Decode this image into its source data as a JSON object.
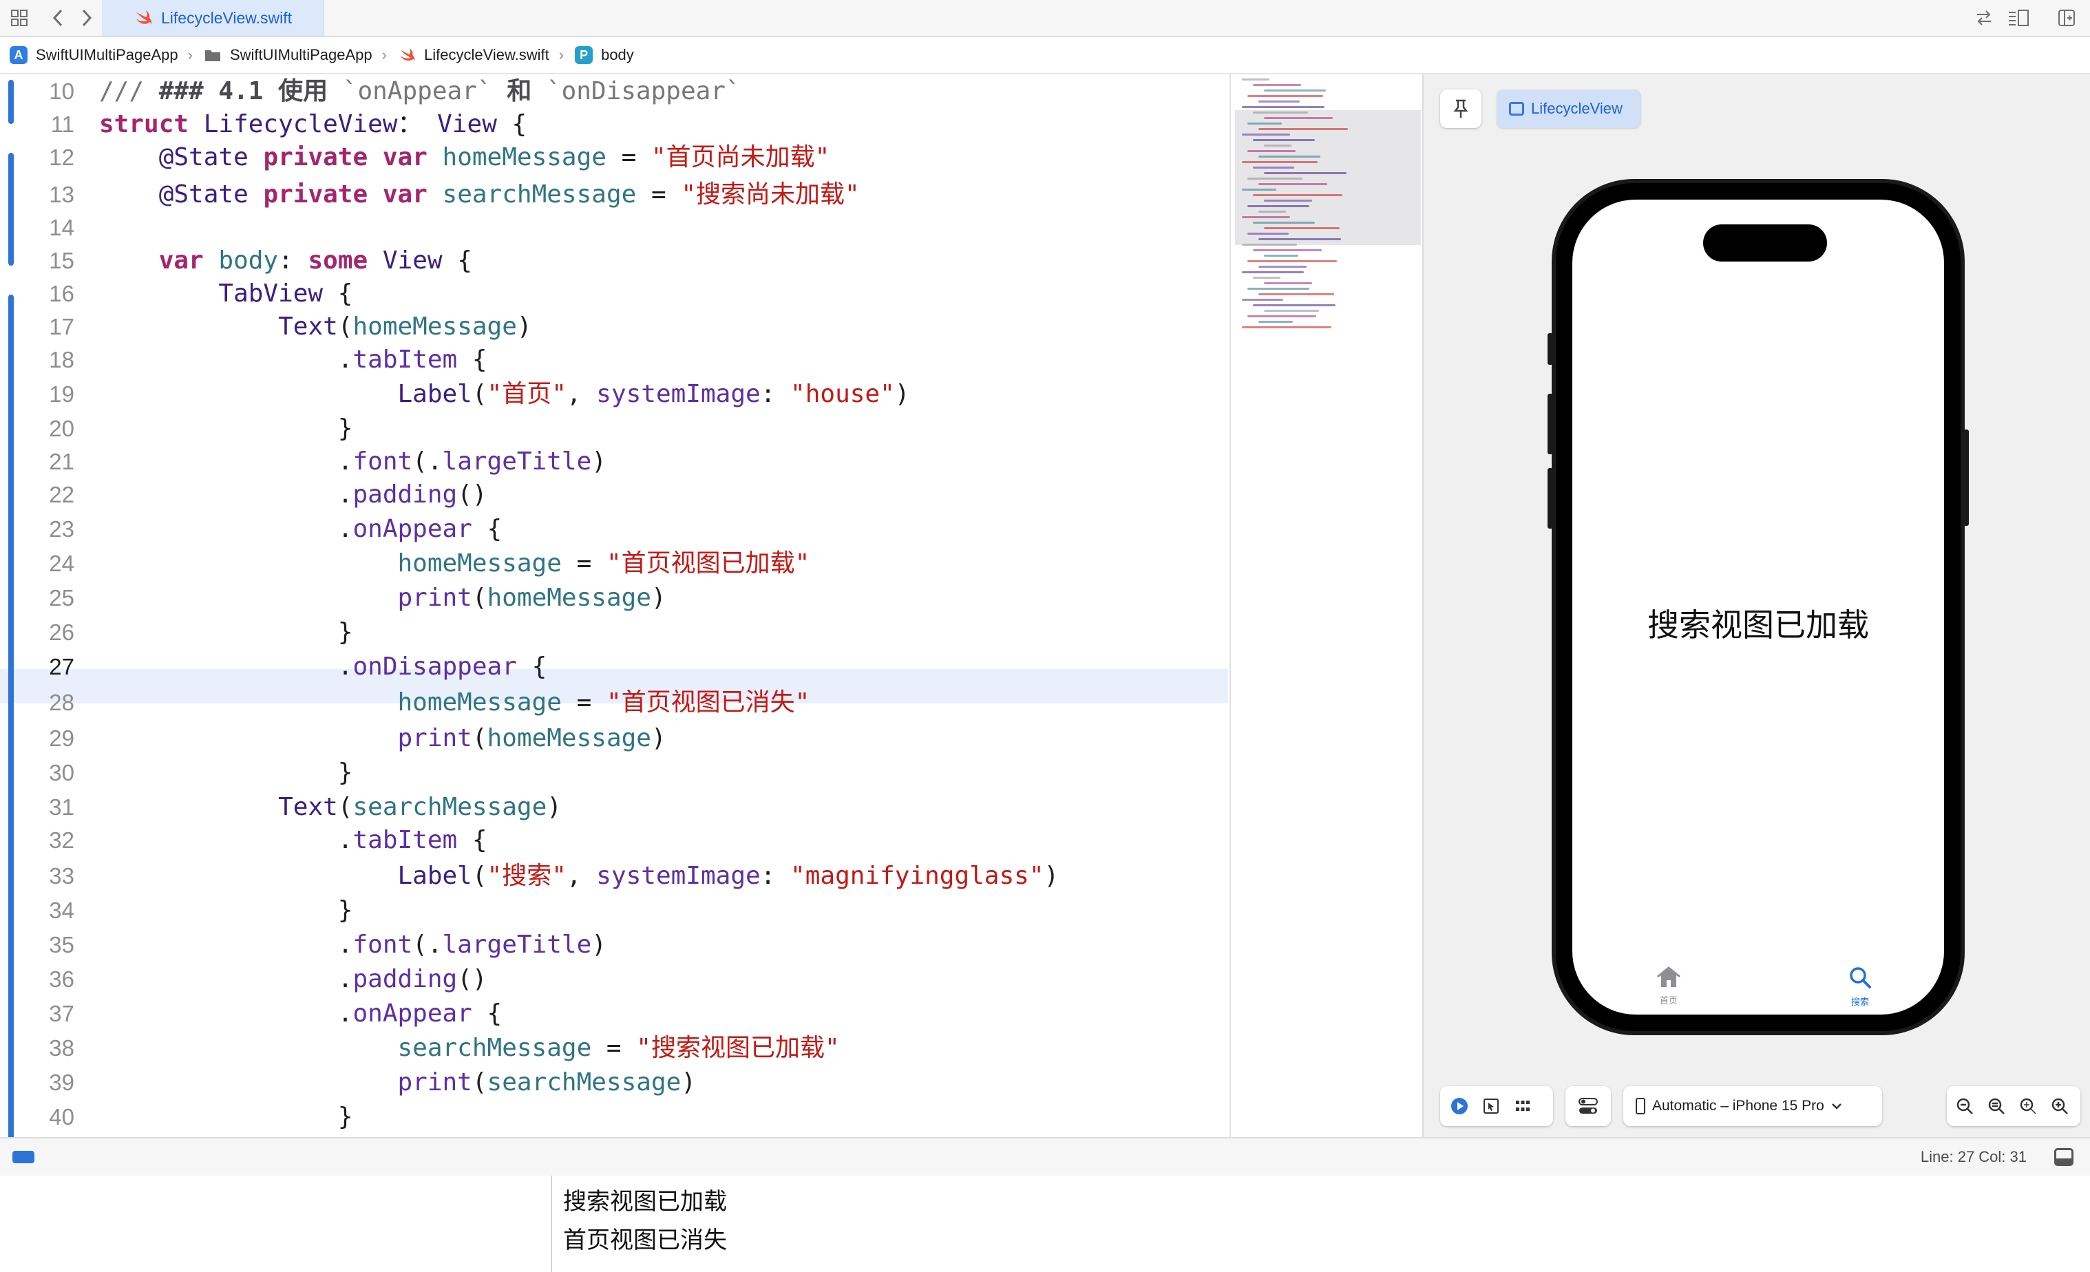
{
  "tab": {
    "title": "LifecycleView.swift"
  },
  "breadcrumb": {
    "project": "SwiftUIMultiPageApp",
    "folder": "SwiftUIMultiPageApp",
    "file": "LifecycleView.swift",
    "symbol_badge": "P",
    "symbol": "body"
  },
  "editor": {
    "current_line": 27,
    "lines": [
      {
        "n": "10",
        "tokens": [
          [
            "cm",
            "/// "
          ],
          [
            "cmb",
            "### 4.1 使用"
          ],
          [
            "cm",
            " `onAppear` "
          ],
          [
            "cmb",
            "和"
          ],
          [
            "cm",
            " `onDisappear`"
          ]
        ]
      },
      {
        "n": "11",
        "tokens": [
          [
            "kw",
            "struct "
          ],
          [
            "ty",
            "LifecycleView"
          ],
          [
            "",
            "："
          ],
          [
            "ty",
            " View"
          ],
          [
            "",
            " {"
          ]
        ]
      },
      {
        "n": "12",
        "tokens": [
          [
            "",
            "    "
          ],
          [
            "ty",
            "@State"
          ],
          [
            "",
            " "
          ],
          [
            "kw",
            "private var "
          ],
          [
            "pr",
            "homeMessage"
          ],
          [
            "",
            " = "
          ],
          [
            "st",
            "\"首页尚未加载\""
          ]
        ]
      },
      {
        "n": "13",
        "tokens": [
          [
            "",
            "    "
          ],
          [
            "ty",
            "@State"
          ],
          [
            "",
            " "
          ],
          [
            "kw",
            "private var "
          ],
          [
            "pr",
            "searchMessage"
          ],
          [
            "",
            " = "
          ],
          [
            "st",
            "\"搜索尚未加载\""
          ]
        ]
      },
      {
        "n": "14",
        "tokens": []
      },
      {
        "n": "15",
        "tokens": [
          [
            "",
            "    "
          ],
          [
            "kw",
            "var "
          ],
          [
            "pr",
            "body"
          ],
          [
            "",
            ": "
          ],
          [
            "kw",
            "some "
          ],
          [
            "ty",
            "View"
          ],
          [
            "",
            " {"
          ]
        ]
      },
      {
        "n": "16",
        "tokens": [
          [
            "",
            "        "
          ],
          [
            "ty",
            "TabView"
          ],
          [
            "",
            " {"
          ]
        ]
      },
      {
        "n": "17",
        "tokens": [
          [
            "",
            "            "
          ],
          [
            "ty",
            "Text"
          ],
          [
            "",
            "("
          ],
          [
            "pr",
            "homeMessage"
          ],
          [
            "",
            ")"
          ]
        ]
      },
      {
        "n": "18",
        "tokens": [
          [
            "",
            "                ."
          ],
          [
            "fn",
            "tabItem"
          ],
          [
            "",
            " {"
          ]
        ]
      },
      {
        "n": "19",
        "tokens": [
          [
            "",
            "                    "
          ],
          [
            "ty",
            "Label"
          ],
          [
            "",
            "("
          ],
          [
            "st",
            "\"首页\""
          ],
          [
            "",
            ", "
          ],
          [
            "fn",
            "systemImage"
          ],
          [
            "",
            ": "
          ],
          [
            "st",
            "\"house\""
          ],
          [
            "",
            ")"
          ]
        ]
      },
      {
        "n": "20",
        "tokens": [
          [
            "",
            "                }"
          ]
        ]
      },
      {
        "n": "21",
        "tokens": [
          [
            "",
            "                ."
          ],
          [
            "fn",
            "font"
          ],
          [
            "",
            "(."
          ],
          [
            "fn",
            "largeTitle"
          ],
          [
            "",
            ")"
          ]
        ]
      },
      {
        "n": "22",
        "tokens": [
          [
            "",
            "                ."
          ],
          [
            "fn",
            "padding"
          ],
          [
            "",
            "()"
          ]
        ]
      },
      {
        "n": "23",
        "tokens": [
          [
            "",
            "                ."
          ],
          [
            "fn",
            "onAppear"
          ],
          [
            "",
            " {"
          ]
        ]
      },
      {
        "n": "24",
        "tokens": [
          [
            "",
            "                    "
          ],
          [
            "pr",
            "homeMessage"
          ],
          [
            "",
            " = "
          ],
          [
            "st",
            "\"首页视图已加载\""
          ]
        ]
      },
      {
        "n": "25",
        "tokens": [
          [
            "",
            "                    "
          ],
          [
            "fn",
            "print"
          ],
          [
            "",
            "("
          ],
          [
            "pr",
            "homeMessage"
          ],
          [
            "",
            ")"
          ]
        ]
      },
      {
        "n": "26",
        "tokens": [
          [
            "",
            "                }"
          ]
        ]
      },
      {
        "n": "27",
        "tokens": [
          [
            "",
            "                ."
          ],
          [
            "fn",
            "onDisappear"
          ],
          [
            "",
            " {"
          ]
        ]
      },
      {
        "n": "28",
        "tokens": [
          [
            "",
            "                    "
          ],
          [
            "pr",
            "homeMessage"
          ],
          [
            "",
            " = "
          ],
          [
            "st",
            "\"首页视图已消失\""
          ]
        ]
      },
      {
        "n": "29",
        "tokens": [
          [
            "",
            "                    "
          ],
          [
            "fn",
            "print"
          ],
          [
            "",
            "("
          ],
          [
            "pr",
            "homeMessage"
          ],
          [
            "",
            ")"
          ]
        ]
      },
      {
        "n": "30",
        "tokens": [
          [
            "",
            "                }"
          ]
        ]
      },
      {
        "n": "31",
        "tokens": [
          [
            "",
            "            "
          ],
          [
            "ty",
            "Text"
          ],
          [
            "",
            "("
          ],
          [
            "pr",
            "searchMessage"
          ],
          [
            "",
            ")"
          ]
        ]
      },
      {
        "n": "32",
        "tokens": [
          [
            "",
            "                ."
          ],
          [
            "fn",
            "tabItem"
          ],
          [
            "",
            " {"
          ]
        ]
      },
      {
        "n": "33",
        "tokens": [
          [
            "",
            "                    "
          ],
          [
            "ty",
            "Label"
          ],
          [
            "",
            "("
          ],
          [
            "st",
            "\"搜索\""
          ],
          [
            "",
            ", "
          ],
          [
            "fn",
            "systemImage"
          ],
          [
            "",
            ": "
          ],
          [
            "st",
            "\"magnifyingglass\""
          ],
          [
            "",
            ")"
          ]
        ]
      },
      {
        "n": "34",
        "tokens": [
          [
            "",
            "                }"
          ]
        ]
      },
      {
        "n": "35",
        "tokens": [
          [
            "",
            "                ."
          ],
          [
            "fn",
            "font"
          ],
          [
            "",
            "(."
          ],
          [
            "fn",
            "largeTitle"
          ],
          [
            "",
            ")"
          ]
        ]
      },
      {
        "n": "36",
        "tokens": [
          [
            "",
            "                ."
          ],
          [
            "fn",
            "padding"
          ],
          [
            "",
            "()"
          ]
        ]
      },
      {
        "n": "37",
        "tokens": [
          [
            "",
            "                ."
          ],
          [
            "fn",
            "onAppear"
          ],
          [
            "",
            " {"
          ]
        ]
      },
      {
        "n": "38",
        "tokens": [
          [
            "",
            "                    "
          ],
          [
            "pr",
            "searchMessage"
          ],
          [
            "",
            " = "
          ],
          [
            "st",
            "\"搜索视图已加载\""
          ]
        ]
      },
      {
        "n": "39",
        "tokens": [
          [
            "",
            "                    "
          ],
          [
            "fn",
            "print"
          ],
          [
            "",
            "("
          ],
          [
            "pr",
            "searchMessage"
          ],
          [
            "",
            ")"
          ]
        ]
      },
      {
        "n": "40",
        "tokens": [
          [
            "",
            "                }"
          ]
        ]
      }
    ]
  },
  "preview": {
    "chip_label": "LifecycleView",
    "screen_text": "搜索视图已加载",
    "tab_home_label": "首页",
    "tab_search_label": "搜索",
    "device_label": "Automatic – iPhone 15 Pro"
  },
  "status": {
    "cursor": "Line: 27  Col: 31"
  },
  "console": {
    "lines": [
      "搜索视图已加载",
      "首页视图已消失"
    ]
  },
  "colors": {
    "keyword": "#a5256c",
    "type": "#3a1e82",
    "property": "#2f7583",
    "string": "#c41a16",
    "function": "#5d2fa4",
    "comment": "#76767c",
    "accent": "#1f5fd3",
    "highlight_line": "#e9f0fb"
  },
  "icons": [
    "grid-icon",
    "chevron-left-icon",
    "chevron-right-icon",
    "swift-icon",
    "folder-icon",
    "app-icon",
    "pin-icon",
    "play-icon",
    "select-icon",
    "variants-icon",
    "settings-icon",
    "device-icon",
    "zoom-out-icon",
    "zoom-in-icon",
    "house-icon",
    "magnifyingglass-icon"
  ]
}
